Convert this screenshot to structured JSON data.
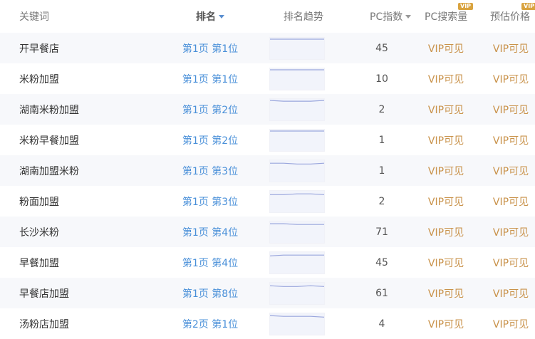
{
  "header": {
    "keyword": "关键词",
    "rank": "排名",
    "trend": "排名趋势",
    "pc_index": "PC指数",
    "pc_search": "PC搜索量",
    "price": "预估价格",
    "vip_badge": "VIP"
  },
  "rows": [
    {
      "keyword": "开早餐店",
      "rank": "第1页 第1位",
      "pc": "45",
      "vol": "VIP可见",
      "price": "VIP可见",
      "trend": [
        1,
        1,
        1,
        1,
        1
      ]
    },
    {
      "keyword": "米粉加盟",
      "rank": "第1页 第1位",
      "pc": "10",
      "vol": "VIP可见",
      "price": "VIP可见",
      "trend": [
        1,
        1,
        1,
        1,
        1
      ]
    },
    {
      "keyword": "湖南米粉加盟",
      "rank": "第1页 第2位",
      "pc": "2",
      "vol": "VIP可见",
      "price": "VIP可见",
      "trend": [
        1,
        2,
        2,
        2,
        1
      ]
    },
    {
      "keyword": "米粉早餐加盟",
      "rank": "第1页 第2位",
      "pc": "1",
      "vol": "VIP可见",
      "price": "VIP可见",
      "trend": [
        1,
        1,
        1,
        1,
        1
      ]
    },
    {
      "keyword": "湖南加盟米粉",
      "rank": "第1页 第3位",
      "pc": "1",
      "vol": "VIP可见",
      "price": "VIP可见",
      "trend": [
        3,
        3,
        4,
        4,
        3
      ]
    },
    {
      "keyword": "粉面加盟",
      "rank": "第1页 第3位",
      "pc": "2",
      "vol": "VIP可见",
      "price": "VIP可见",
      "trend": [
        4,
        4,
        3,
        3,
        4
      ]
    },
    {
      "keyword": "长沙米粉",
      "rank": "第1页 第4位",
      "pc": "71",
      "vol": "VIP可见",
      "price": "VIP可见",
      "trend": [
        2,
        2,
        3,
        3,
        3
      ]
    },
    {
      "keyword": "早餐加盟",
      "rank": "第1页 第4位",
      "pc": "45",
      "vol": "VIP可见",
      "price": "VIP可见",
      "trend": [
        4,
        3,
        3,
        3,
        3
      ]
    },
    {
      "keyword": "早餐店加盟",
      "rank": "第1页 第8位",
      "pc": "61",
      "vol": "VIP可见",
      "price": "VIP可见",
      "trend": [
        3,
        4,
        4,
        3,
        4
      ]
    },
    {
      "keyword": "汤粉店加盟",
      "rank": "第2页 第1位",
      "pc": "4",
      "vol": "VIP可见",
      "price": "VIP可见",
      "trend": [
        2,
        3,
        3,
        3,
        4
      ]
    }
  ],
  "colors": {
    "rank_link": "#4a90d9",
    "vip_text": "#c9924a",
    "spark_line": "#9aa6dd",
    "spark_bg": "#f2f4fb"
  }
}
